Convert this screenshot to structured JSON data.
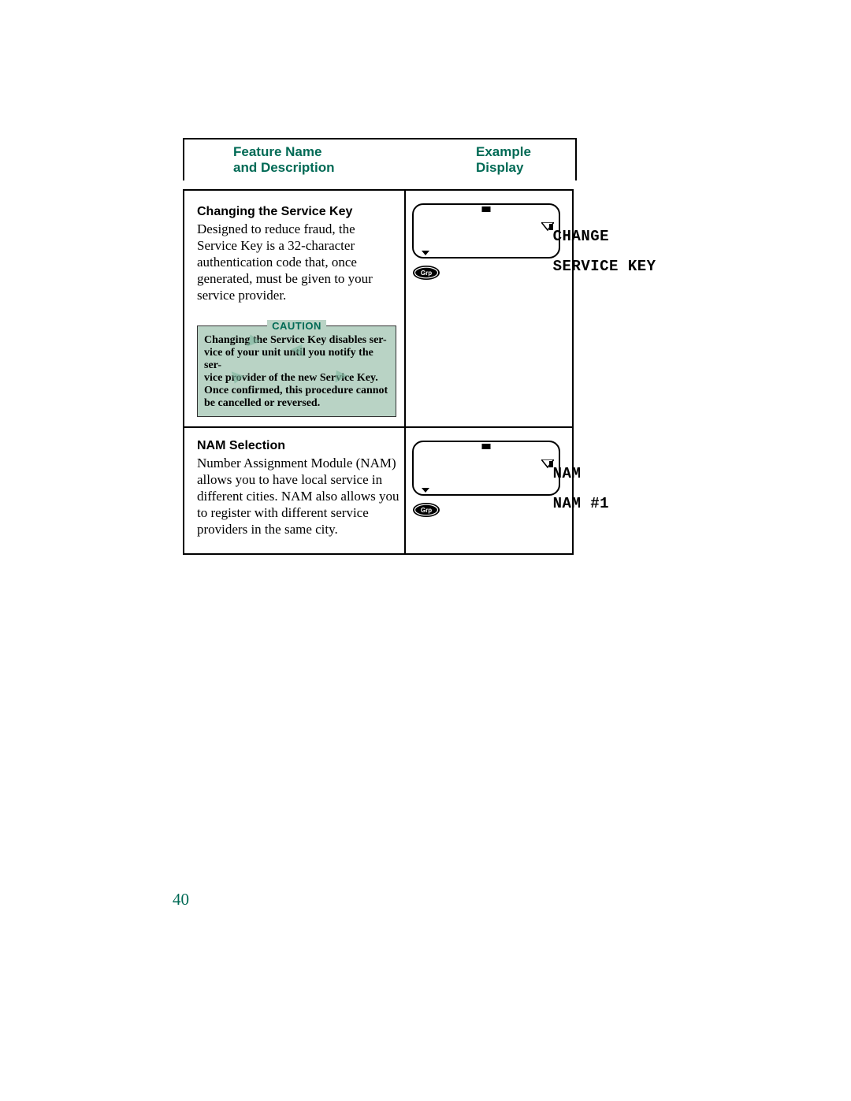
{
  "header": {
    "left_line1": "Feature Name",
    "left_line2": "and Description",
    "right_line1": "Example",
    "right_line2": "Display"
  },
  "row1": {
    "title": "Changing the Service Key",
    "body": "Designed to reduce fraud, the Service Key is a 32-character authentication code that, once generated, must be given to your service provider.",
    "caution_label": "CAUTION",
    "caution_text": "Changing the Service Key disables ser-\nvice of your unit until you notify the ser-\nvice provider of the new Service Key.\nOnce confirmed, this procedure cannot\nbe cancelled or reversed.",
    "display_line1": "CHANGE",
    "display_line2": "SERVICE KEY",
    "grp_label": "Grp"
  },
  "row2": {
    "title": "NAM Selection",
    "body": "Number Assignment Module (NAM) allows you to have local service in different cities. NAM also allows you to register with different service providers in the same city.",
    "display_line1": "NAM",
    "display_line2": "NAM #1",
    "grp_label": "Grp"
  },
  "page_number": "40"
}
